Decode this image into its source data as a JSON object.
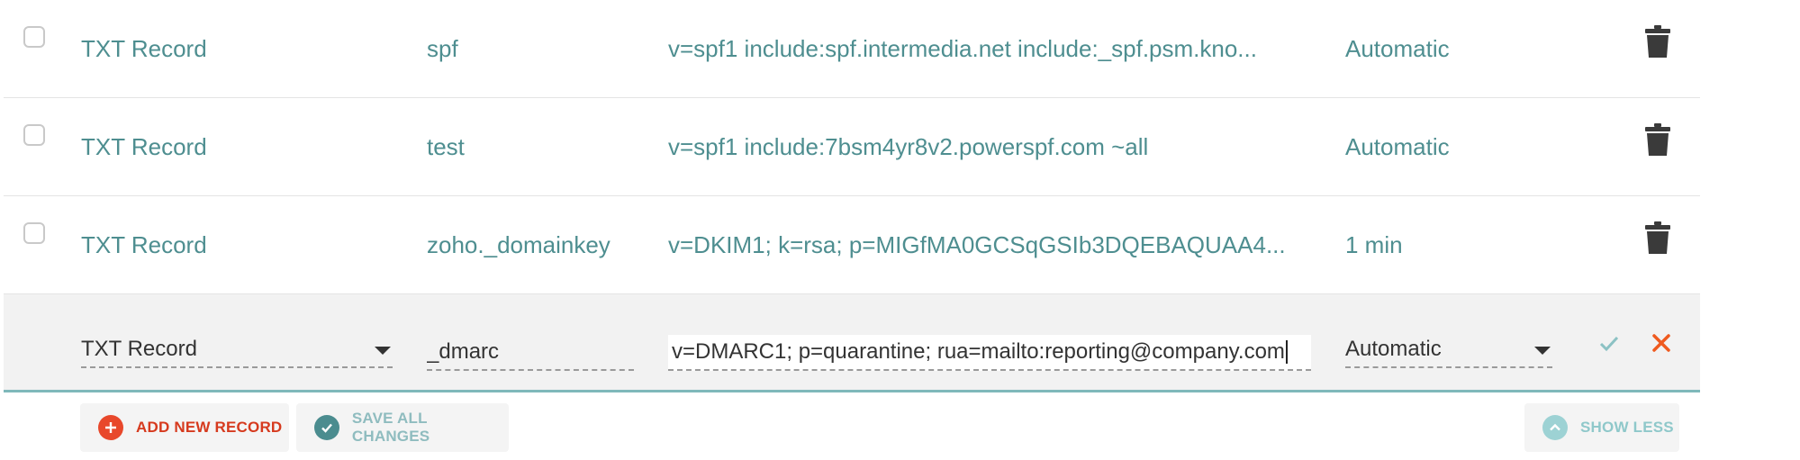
{
  "records": [
    {
      "type": "TXT Record",
      "host": "spf",
      "value": "v=spf1 include:spf.intermedia.net include:_spf.psm.kno...",
      "ttl": "Automatic",
      "delete_icon": "trash-icon"
    },
    {
      "type": "TXT Record",
      "host": "test",
      "value": "v=spf1 include:7bsm4yr8v2.powerspf.com ~all",
      "ttl": "Automatic",
      "delete_icon": "trash-icon"
    },
    {
      "type": "TXT Record",
      "host": "zoho._domainkey",
      "value": "v=DKIM1; k=rsa; p=MIGfMA0GCSqGSIb3DQEBAQUAA4...",
      "ttl": "1 min",
      "delete_icon": "trash-icon"
    }
  ],
  "edit_row": {
    "type": "TXT Record",
    "host": "_dmarc",
    "value": "v=DMARC1; p=quarantine; rua=mailto:reporting@company.com",
    "ttl": "Automatic",
    "confirm_icon": "check-icon",
    "cancel_icon": "close-icon"
  },
  "actions": {
    "add_label": "ADD NEW RECORD",
    "save_label": "SAVE ALL CHANGES",
    "show_less_label": "SHOW LESS"
  },
  "colors": {
    "teal_text": "#4e8e90",
    "add_red": "#e8482b",
    "save_teal": "#4b8c8f",
    "accent_border": "#7fb8ba"
  }
}
